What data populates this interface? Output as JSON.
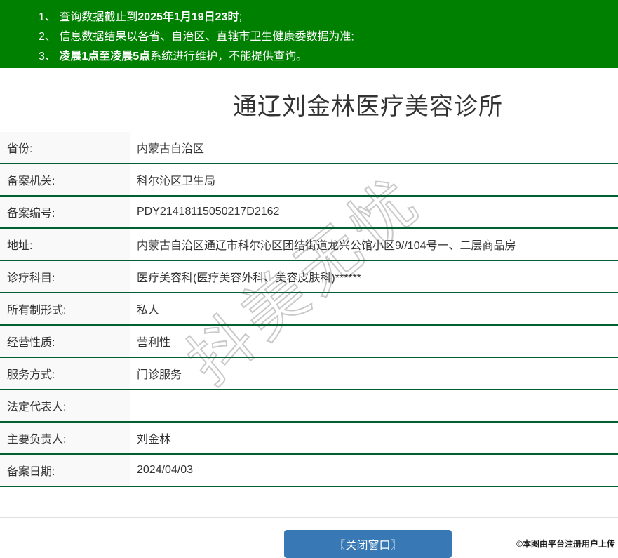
{
  "colors": {
    "notice_bg": "#008000",
    "separator_green": "#006030",
    "label_bg": "#f9f9f9",
    "button_blue": "#3879b5",
    "watermark_gray": "#c9c9c9",
    "text": "#333333"
  },
  "notice": {
    "lines": [
      {
        "pre": "1、 查询数据截止到",
        "bold": "2025年1月19日23时",
        "post": ";"
      },
      {
        "pre": "2、 信息数据结果以各省、自治区、直辖市卫生健康委数据为准;",
        "bold": "",
        "post": ""
      },
      {
        "pre": "3、 ",
        "bold": "凌晨1点至凌晨5点",
        "post": "系统进行维护，不能提供查询。"
      }
    ]
  },
  "title": "通辽刘金林医疗美容诊所",
  "table": {
    "rows": [
      {
        "label": "省份:",
        "value": "内蒙古自治区"
      },
      {
        "label": "备案机关:",
        "value": "科尔沁区卫生局"
      },
      {
        "label": "备案编号:",
        "value": "PDY21418115050217D2162"
      },
      {
        "label": "地址:",
        "value": "内蒙古自治区通辽市科尔沁区团结街道龙兴公馆小区9//104号一、二层商品房"
      },
      {
        "label": "诊疗科目:",
        "value": "医疗美容科(医疗美容外科、美容皮肤科)******"
      },
      {
        "label": "所有制形式:",
        "value": "私人"
      },
      {
        "label": "经营性质:",
        "value": "营利性"
      },
      {
        "label": "服务方式:",
        "value": "门诊服务"
      },
      {
        "label": "法定代表人:",
        "value": ""
      },
      {
        "label": "主要负责人:",
        "value": "刘金林"
      },
      {
        "label": "备案日期:",
        "value": "2024/04/03"
      }
    ]
  },
  "watermark": "抖美无忧",
  "footer": {
    "close_button_label": "〖关闭窗口〗",
    "attribution": "©本图由平台注册用户上传"
  }
}
